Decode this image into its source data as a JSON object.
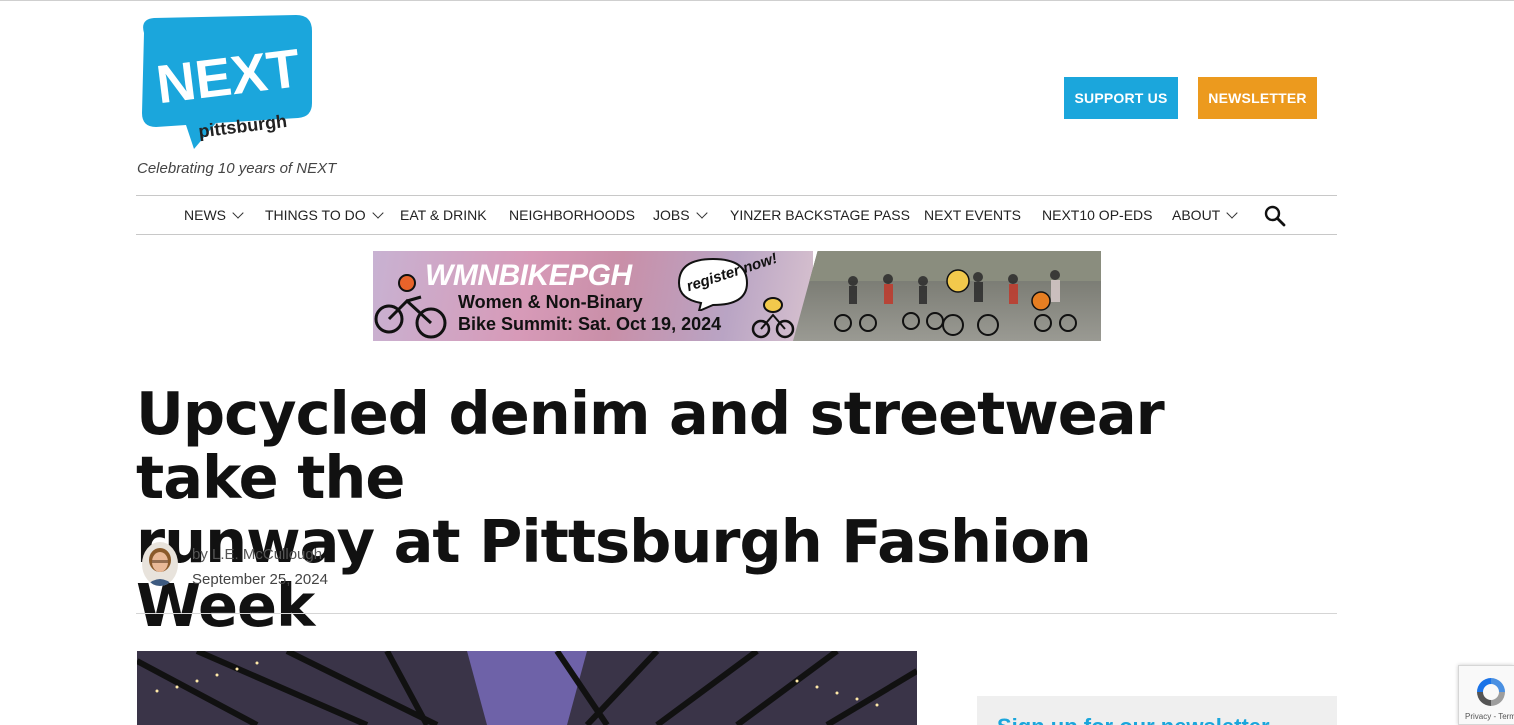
{
  "site": {
    "logo_text": "NEXT",
    "logo_subtext": "pittsburgh",
    "tagline": "Celebrating 10 years of NEXT",
    "brand_color": "#1ba6dc",
    "accent_color": "#ec9a1e"
  },
  "header": {
    "support_label": "SUPPORT US",
    "newsletter_label": "NEWSLETTER"
  },
  "nav": {
    "items": [
      {
        "label": "NEWS",
        "dropdown": true
      },
      {
        "label": "THINGS TO DO",
        "dropdown": true
      },
      {
        "label": "EAT & DRINK",
        "dropdown": false
      },
      {
        "label": "NEIGHBORHOODS",
        "dropdown": false
      },
      {
        "label": "JOBS",
        "dropdown": true
      },
      {
        "label": "YINZER BACKSTAGE PASS",
        "dropdown": false
      },
      {
        "label": "NEXT EVENTS",
        "dropdown": false
      },
      {
        "label": "NEXT10 OP-EDS",
        "dropdown": false
      },
      {
        "label": "ABOUT",
        "dropdown": true
      }
    ],
    "search_icon": "search-icon"
  },
  "banner": {
    "title": "WMNBIKEPGH",
    "line1": "Women & Non-Binary",
    "line2": "Bike Summit:  Sat. Oct 19, 2024",
    "bubble": "register now!"
  },
  "article": {
    "headline_line1": "Upcycled denim and streetwear take the",
    "headline_line2": "runway at Pittsburgh Fashion Week",
    "byline_prefix": "by ",
    "author": "L.E. McCullough",
    "date": "September 25, 2024"
  },
  "sidebar": {
    "heading_partial": "Sign up for our newsletter"
  },
  "recaptcha": {
    "footer": "Privacy - Terms"
  }
}
